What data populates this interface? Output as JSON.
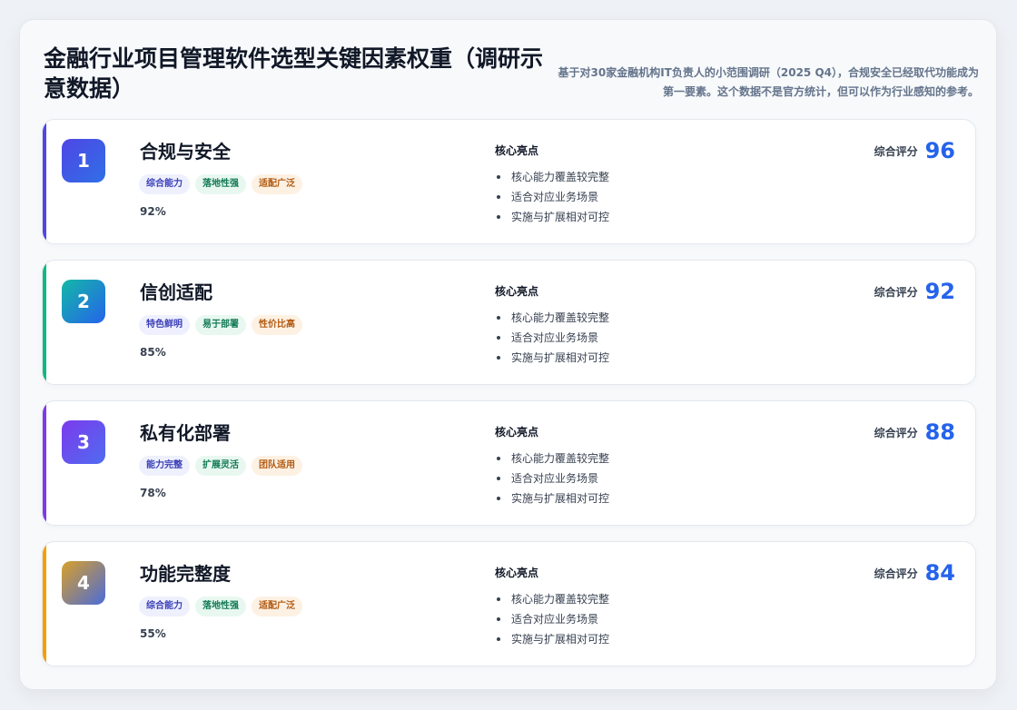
{
  "header": {
    "title": "金融行业项目管理软件选型关键因素权重（调研示意数据）",
    "subtitle": "基于对30家金融机构IT负责人的小范围调研（2025 Q4），合规安全已经取代功能成为第一要素。这个数据不是官方统计，但可以作为行业感知的参考。"
  },
  "colors": {
    "accent_1": "#4f46e5",
    "accent_2": "#10b981",
    "accent_3": "#7c3aed",
    "accent_4": "#f59e0b",
    "score": "#2563eb"
  },
  "cards": [
    {
      "rank": "1",
      "name": "合规与安全",
      "tags": [
        "综合能力",
        "落地性强",
        "适配广泛"
      ],
      "percent": "92%",
      "highlights_title": "核心亮点",
      "highlights": [
        "核心能力覆盖较完整",
        "适合对应业务场景",
        "实施与扩展相对可控"
      ],
      "score_label": "综合评分",
      "score": "96"
    },
    {
      "rank": "2",
      "name": "信创适配",
      "tags": [
        "特色鲜明",
        "易于部署",
        "性价比高"
      ],
      "percent": "85%",
      "highlights_title": "核心亮点",
      "highlights": [
        "核心能力覆盖较完整",
        "适合对应业务场景",
        "实施与扩展相对可控"
      ],
      "score_label": "综合评分",
      "score": "92"
    },
    {
      "rank": "3",
      "name": "私有化部署",
      "tags": [
        "能力完整",
        "扩展灵活",
        "团队适用"
      ],
      "percent": "78%",
      "highlights_title": "核心亮点",
      "highlights": [
        "核心能力覆盖较完整",
        "适合对应业务场景",
        "实施与扩展相对可控"
      ],
      "score_label": "综合评分",
      "score": "88"
    },
    {
      "rank": "4",
      "name": "功能完整度",
      "tags": [
        "综合能力",
        "落地性强",
        "适配广泛"
      ],
      "percent": "55%",
      "highlights_title": "核心亮点",
      "highlights": [
        "核心能力覆盖较完整",
        "适合对应业务场景",
        "实施与扩展相对可控"
      ],
      "score_label": "综合评分",
      "score": "84"
    }
  ]
}
